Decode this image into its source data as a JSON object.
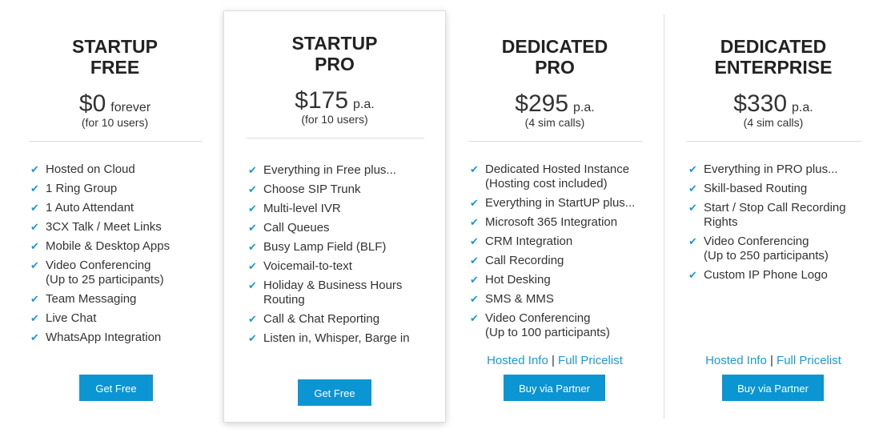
{
  "plans": [
    {
      "title1": "STARTUP",
      "title2": "FREE",
      "price": "$0",
      "period": "forever",
      "sub": "(for 10 users)",
      "features": [
        [
          "Hosted on Cloud"
        ],
        [
          "1 Ring Group"
        ],
        [
          "1 Auto Attendant"
        ],
        [
          "3CX Talk / Meet Links"
        ],
        [
          "Mobile & Desktop Apps"
        ],
        [
          "Video Conferencing",
          "(Up to 25 participants)"
        ],
        [
          "Team Messaging"
        ],
        [
          "Live Chat"
        ],
        [
          "WhatsApp Integration"
        ]
      ],
      "button": "Get Free"
    },
    {
      "title1": "STARTUP",
      "title2": "PRO",
      "price": "$175",
      "period": "p.a.",
      "sub": "(for 10 users)",
      "features": [
        [
          "Everything in Free plus..."
        ],
        [
          "Choose SIP Trunk"
        ],
        [
          "Multi-level IVR"
        ],
        [
          "Call Queues"
        ],
        [
          "Busy Lamp Field (BLF)"
        ],
        [
          "Voicemail-to-text"
        ],
        [
          "Holiday & Business Hours",
          "Routing"
        ],
        [
          "Call & Chat Reporting"
        ],
        [
          "Listen in, Whisper, Barge in"
        ]
      ],
      "button": "Get Free"
    },
    {
      "title1": "DEDICATED",
      "title2": "PRO",
      "price": "$295",
      "period": "p.a.",
      "sub": "(4 sim calls)",
      "features": [
        [
          "Dedicated Hosted Instance",
          "(Hosting cost included)"
        ],
        [
          "Everything in StartUP plus..."
        ],
        [
          "Microsoft 365 Integration"
        ],
        [
          "CRM Integration"
        ],
        [
          "Call Recording"
        ],
        [
          "Hot Desking"
        ],
        [
          "SMS & MMS"
        ],
        [
          "Video Conferencing",
          "(Up to 100 participants)"
        ]
      ],
      "link1": "Hosted Info",
      "sep": "|",
      "link2": "Full Pricelist",
      "button": "Buy via Partner"
    },
    {
      "title1": "DEDICATED",
      "title2": "ENTERPRISE",
      "price": "$330",
      "period": "p.a.",
      "sub": "(4 sim calls)",
      "features": [
        [
          "Everything in PRO plus..."
        ],
        [
          "Skill-based Routing"
        ],
        [
          "Start / Stop Call Recording",
          "Rights"
        ],
        [
          "Video Conferencing",
          "(Up to 250 participants)"
        ],
        [
          "Custom IP Phone Logo"
        ]
      ],
      "link1": "Hosted Info",
      "sep": "|",
      "link2": "Full Pricelist",
      "button": "Buy via Partner"
    }
  ],
  "colors": {
    "accent": "#0b95d3",
    "check": "#1a9ad6",
    "border": "#dddddd"
  }
}
